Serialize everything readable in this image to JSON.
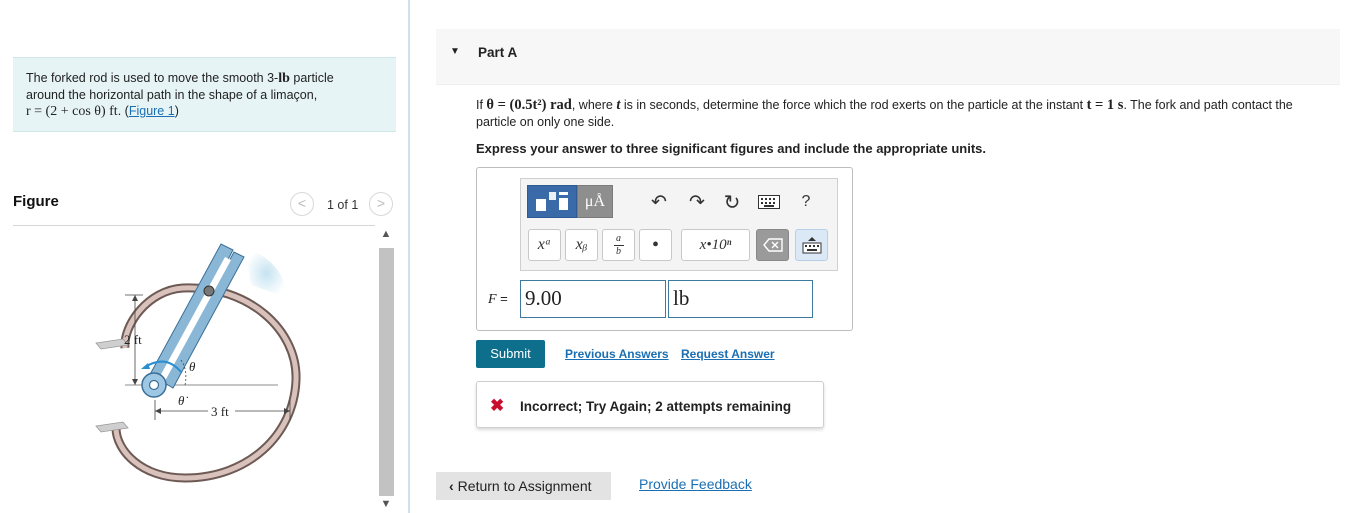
{
  "problem": {
    "line1": "The forked rod is used to move the smooth 3-",
    "line1_unit": "lb",
    "line1_end": " particle",
    "line2": "around the horizontal path in the shape of a limaçon,",
    "equation": "r = (2 + cos θ) ft",
    "dot": ". ",
    "figure_link": "Figure 1",
    "paren_open": "(",
    "paren_close": ")"
  },
  "figure_panel": {
    "heading": "Figure",
    "counter": "1 of 1",
    "prev_symbol": "<",
    "next_symbol": ">",
    "scroll_up": "▲",
    "scroll_down": "▼",
    "labels": {
      "dim_2ft": "2 ft",
      "dim_3ft": "3 ft",
      "theta": "θ",
      "theta_dot": "θ̇"
    }
  },
  "part": {
    "toggle": "▼",
    "title": "Part A"
  },
  "question": {
    "p1": "If ",
    "theta_expr": "θ = (0.5t²) rad",
    "p2": ", where ",
    "t_var": "t",
    "p3": " is in seconds, determine the force which the rod exerts on the particle at the instant ",
    "t_expr": "t = 1 s",
    "p4": ". The fork and path contact the particle on only one side."
  },
  "instruction": "Express your answer to three significant figures and include the appropriate units.",
  "toolbar": {
    "units_label": "μÅ",
    "undo_icon": "↶",
    "redo_icon": "↷",
    "reset_icon": "↻",
    "help_label": "?",
    "superscript_label": "xᵃ",
    "subscript_label": "xᵦ",
    "fraction_num": "a",
    "fraction_den": "b",
    "dot_label": "•",
    "sci_label": "x•10ⁿ"
  },
  "answer": {
    "variable_label": "F",
    "equals": " =",
    "value": "9.00",
    "unit": "lb"
  },
  "actions": {
    "submit": "Submit",
    "previous_answers": "Previous Answers",
    "request_answer": "Request Answer"
  },
  "feedback": {
    "icon": "✖",
    "message": "Incorrect; Try Again; 2 attempts remaining"
  },
  "footer": {
    "return_chevron": "‹",
    "return_label": "Return to Assignment",
    "provide_feedback": "Provide Feedback"
  },
  "colors": {
    "accent": "#0d6f8c",
    "link": "#1a6fb3",
    "error": "#c8102e",
    "problem_bg": "#e6f4f6"
  }
}
